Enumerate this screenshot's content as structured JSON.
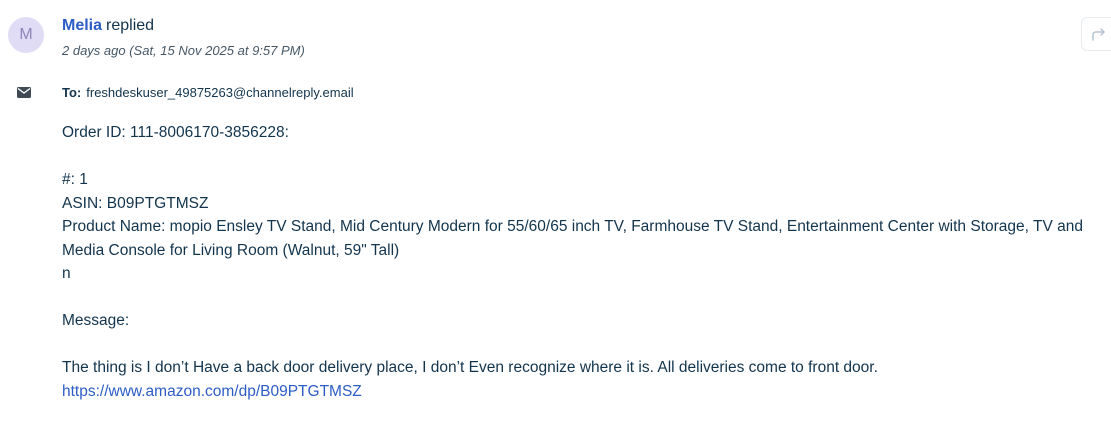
{
  "sender": {
    "avatar_initial": "M",
    "name": "Melia",
    "action": "replied",
    "timestamp": "2 days ago (Sat, 15 Nov 2025 at 9:57 PM)"
  },
  "to": {
    "label": "To:",
    "address": "freshdeskuser_49875263@channelreply.email"
  },
  "message": {
    "order_id": "Order ID: 111-8006170-3856228:",
    "item_number": "#: 1",
    "asin": "ASIN: B09PTGTMSZ",
    "product_name": "Product Name: mopio Ensley TV Stand, Mid Century Modern for 55/60/65 inch TV, Farmhouse TV Stand, Entertainment Center with Storage, TV and Media Console for Living Room (Walnut, 59\" Tall)",
    "stray": "n",
    "message_label": "Message:",
    "message_text": "The thing is I don’t Have a back door delivery place, I don’t Even recognize where it is. All deliveries come to front door.",
    "link": "https://www.amazon.com/dp/B09PTGTMSZ"
  },
  "icons": {
    "forward": "forward-arrow-icon",
    "mail": "envelope-icon"
  },
  "colors": {
    "link": "#2c5cc5",
    "text": "#12344d",
    "avatar_bg": "#e1dcf5"
  }
}
